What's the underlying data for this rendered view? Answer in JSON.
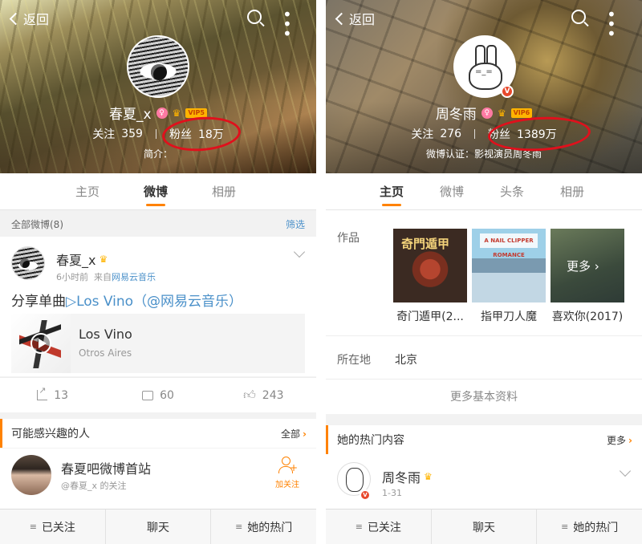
{
  "left": {
    "nav": {
      "back": "返回"
    },
    "profile": {
      "name": "春夏_x",
      "gender": "♀",
      "vip": "VIP5",
      "following_label": "关注",
      "following": "359",
      "fans_label": "粉丝",
      "fans": "18万",
      "intro": "简介："
    },
    "tabs": [
      "主页",
      "微博",
      "相册"
    ],
    "filter": {
      "label": "全部微博(8)",
      "action": "筛选"
    },
    "post": {
      "name": "春夏_x",
      "time": "6小时前",
      "source_prefix": "来自",
      "source": "网易云音乐",
      "text_prefix": "分享单曲",
      "song_link": "▷Los Vino",
      "mention": "（@网易云音乐）",
      "music_title": "Los Vino",
      "music_artist": "Otros Aires",
      "shares": "13",
      "comments": "60",
      "likes": "243"
    },
    "recommend": {
      "title": "可能感兴趣的人",
      "all": "全部",
      "name": "春夏吧微博首站",
      "sub": "@春夏_x 的关注",
      "follow": "加关注"
    },
    "bottom": [
      "已关注",
      "聊天",
      "她的热门"
    ]
  },
  "right": {
    "nav": {
      "back": "返回"
    },
    "profile": {
      "name": "周冬雨",
      "gender": "♀",
      "vip": "VIP6",
      "following_label": "关注",
      "following": "276",
      "fans_label": "粉丝",
      "fans": "1389万",
      "verify": "微博认证：影视演员周冬雨"
    },
    "tabs": [
      "主页",
      "微博",
      "头条",
      "相册"
    ],
    "works_label": "作品",
    "works": [
      {
        "title": "奇门遁甲(2...",
        "cover_text": "奇門遁甲"
      },
      {
        "title": "指甲刀人魔",
        "cover_text": "A NAIL CLIPPER ROMANCE"
      },
      {
        "title": "喜欢你(2017)",
        "cover_text": "更多"
      }
    ],
    "location_label": "所在地",
    "location": "北京",
    "more_info": "更多基本资料",
    "hot": {
      "title": "她的热门内容",
      "more": "更多"
    },
    "post": {
      "name": "周冬雨",
      "date": "1-31"
    },
    "bottom": [
      "已关注",
      "聊天",
      "她的热门"
    ]
  },
  "colors": {
    "accent": "#ff8200",
    "link": "#4a90c9",
    "highlight_circle": "#e0101c",
    "verified": "#e8492d"
  }
}
